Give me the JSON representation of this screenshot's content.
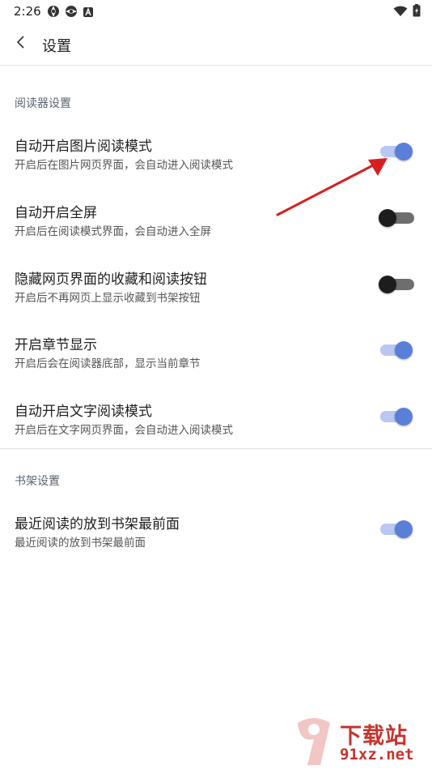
{
  "status_bar": {
    "time": "2:26"
  },
  "toolbar": {
    "title": "设置"
  },
  "sections": [
    {
      "header": "阅读器设置",
      "items": [
        {
          "title": "自动开启图片阅读模式",
          "desc": "开启后在图片网页界面，会自动进入阅读模式",
          "enabled": true
        },
        {
          "title": "自动开启全屏",
          "desc": "开启后在阅读模式界面，会自动进入全屏",
          "enabled": false
        },
        {
          "title": "隐藏网页界面的收藏和阅读按钮",
          "desc": "开启后不再网页上显示收藏到书架按钮",
          "enabled": false
        },
        {
          "title": "开启章节显示",
          "desc": "开启后会在阅读器底部，显示当前章节",
          "enabled": true
        },
        {
          "title": "自动开启文字阅读模式",
          "desc": "开启后在文字网页界面，会自动进入阅读模式",
          "enabled": true
        }
      ]
    },
    {
      "header": "书架设置",
      "items": [
        {
          "title": "最近阅读的放到书架最前面",
          "desc": "最近阅读的放到书架最前面",
          "enabled": true
        }
      ]
    }
  ],
  "watermark": {
    "logo_text": "下载站",
    "url": "91xz.net"
  },
  "colors": {
    "switch_on_thumb": "#5a7fd8",
    "switch_on_track": "#b9c7f2",
    "switch_off_thumb": "#1d1d1d",
    "switch_off_track": "#6e6e6e",
    "annotation_arrow": "#d62020",
    "watermark": "#c6332e"
  }
}
